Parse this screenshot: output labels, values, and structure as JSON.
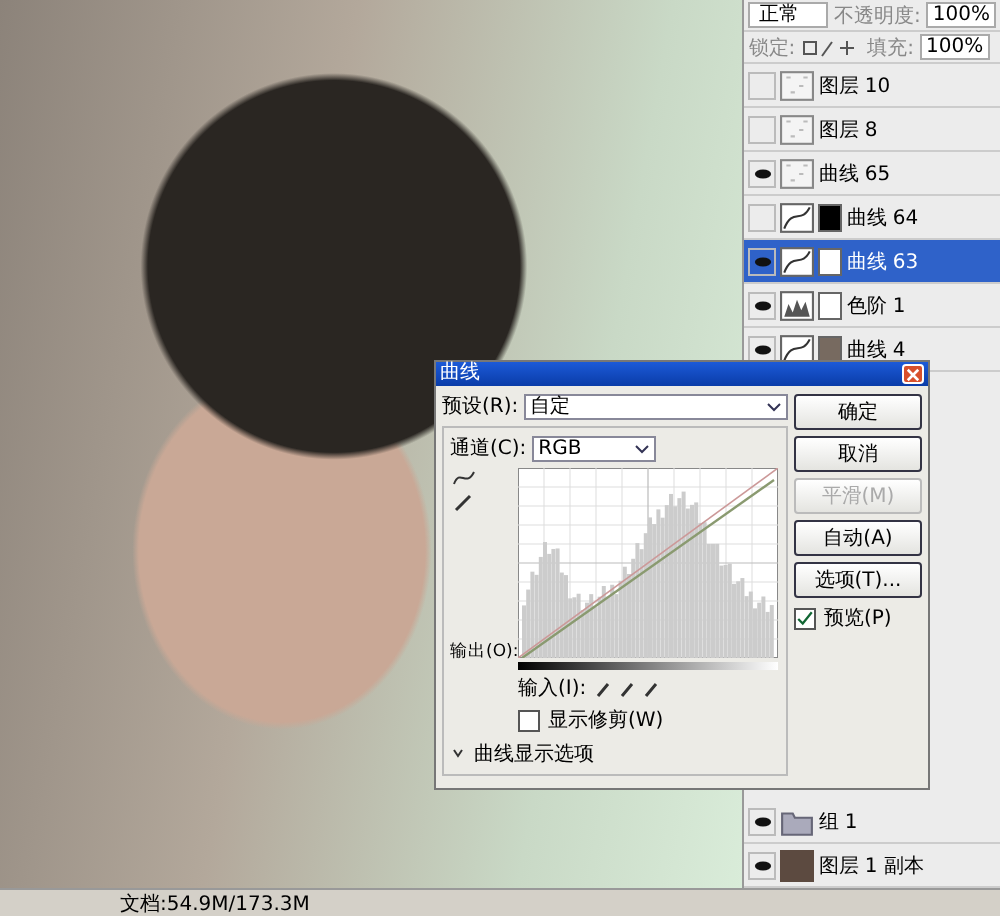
{
  "layers_panel": {
    "blend_mode": "正常",
    "opacity_label": "不透明度:",
    "opacity": "100%",
    "lock_label": "锁定:",
    "fill_label": "填充:",
    "fill": "100%",
    "layers": [
      {
        "name": "图层 10",
        "kind": "pixel",
        "visible": false,
        "selected": false
      },
      {
        "name": "图层 8",
        "kind": "pixel",
        "visible": false,
        "selected": false
      },
      {
        "name": "曲线 65",
        "kind": "pixel",
        "visible": true,
        "selected": false
      },
      {
        "name": "曲线 64",
        "kind": "curves",
        "visible": false,
        "selected": false,
        "mask": {
          "kind": "black"
        }
      },
      {
        "name": "曲线 63",
        "kind": "curves",
        "visible": true,
        "selected": true,
        "mask": {
          "kind": "white"
        }
      },
      {
        "name": "色阶 1",
        "kind": "levels",
        "visible": true,
        "selected": false,
        "mask": {
          "kind": "white"
        }
      },
      {
        "name": "曲线 4",
        "kind": "curves",
        "visible": true,
        "selected": false,
        "mask": {
          "kind": "photo"
        }
      }
    ],
    "bottom_layers": [
      {
        "name": "组 1",
        "kind": "group",
        "visible": true,
        "selected": false
      },
      {
        "name": "图层 1 副本",
        "kind": "photo",
        "visible": true,
        "selected": false
      }
    ]
  },
  "curves_dialog": {
    "title": "曲线",
    "preset_label": "预设(R):",
    "preset": "自定",
    "channel_label": "通道(C):",
    "channel": "RGB",
    "output_label": "输出(O):",
    "input_label": "输入(I):",
    "buttons": [
      {
        "label": "确定",
        "disabled": false
      },
      {
        "label": "取消",
        "disabled": false
      },
      {
        "label": "平滑(M)",
        "disabled": true
      },
      {
        "label": "自动(A)",
        "disabled": false
      },
      {
        "label": "选项(T)...",
        "disabled": false
      }
    ],
    "preview": {
      "label": "预览(P)",
      "checked": true
    },
    "show_clipping": {
      "label": "显示修剪(W)",
      "checked": false
    },
    "display_options": "曲线显示选项"
  },
  "status_bar": {
    "doc": "文档:54.9M/173.3M"
  }
}
